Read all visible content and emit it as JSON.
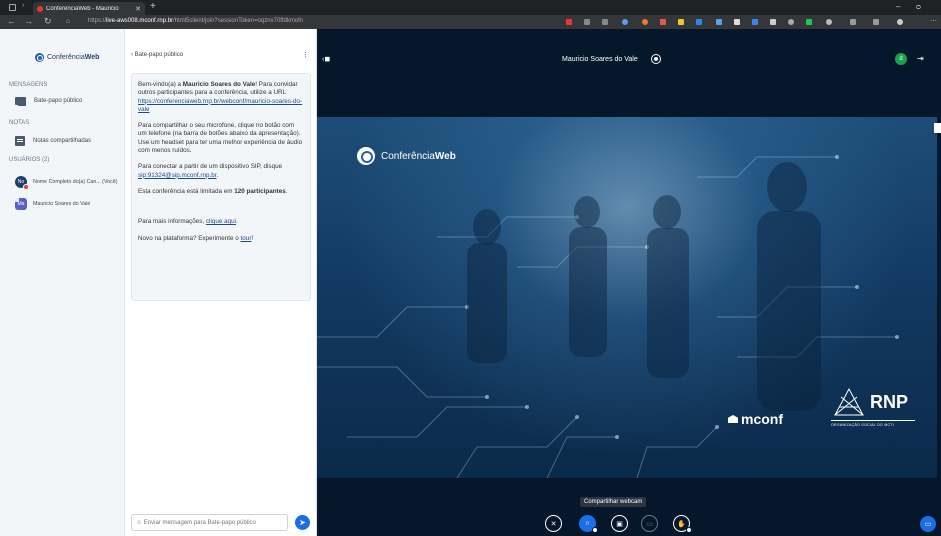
{
  "browser": {
    "tab_title": "ConferênciaWeb - Mauricio",
    "url_prefix": "https://",
    "url_host": "live-aws008.mconf.rnp.br",
    "url_path": "/html5client/join?sessionToken=oqznx70ffdkmofn"
  },
  "leftnav": {
    "brand_prefix": "Conferência",
    "brand_suffix": "Web",
    "messages_header": "MENSAGENS",
    "public_chat_label": "Bate-papo público",
    "notes_header": "NOTAS",
    "shared_notes_label": "Notas compartilhadas",
    "users_header": "USUÁRIOS (2)",
    "users": [
      {
        "initials": "No",
        "name": "Nome Completo do(a) Can... (Você)",
        "color": "#1d3f6b"
      },
      {
        "initials": "Ma",
        "name": "Mauricio Soares do Vale",
        "color": "#5b5fc7"
      }
    ]
  },
  "chat": {
    "header": "Bate-papo público",
    "welcome_intro": "Bem-vindo(a) a ",
    "welcome_name": "Mauricio Soares do Vale",
    "welcome_invite": "! Para convidar outros participantes para a conferência, utilize a URL",
    "welcome_url": "https://conferenciaweb.rnp.br/webconf/mauricio-soares-do-vale",
    "welcome_audio": "Para compartilhar o seu microfone, clique no botão com um telefone (na barra de botões abaixo da apresentação). Use um headset para ter uma melhor experiência de áudio com menos ruídos.",
    "welcome_sip_intro": "Para conectar a partir de um dispositivo SIP, disque ",
    "welcome_sip": "sip:91324@sip.mconf.rnp.br",
    "welcome_limit_intro": "Esta conferência está limitada em ",
    "welcome_limit": "120 participantes",
    "welcome_info_intro": "Para mais informações, ",
    "welcome_info_link": "clique aqui",
    "welcome_new_intro": "Novo na plataforma? Experimente o ",
    "welcome_new_link": "tour",
    "input_placeholder": "Enviar mensagem para Bate-papo público"
  },
  "main": {
    "meeting_title": "Mauricio Soares do Vale",
    "user_initial": "d",
    "slide_brand_prefix": "Conferência",
    "slide_brand_suffix": "Web",
    "slide_mconf": "mconf",
    "slide_rnp": "RNP",
    "slide_rnp_sub": "ORGANIZAÇÃO SOCIAL DO MCTI",
    "tooltip": "Compartilhar webcam"
  }
}
